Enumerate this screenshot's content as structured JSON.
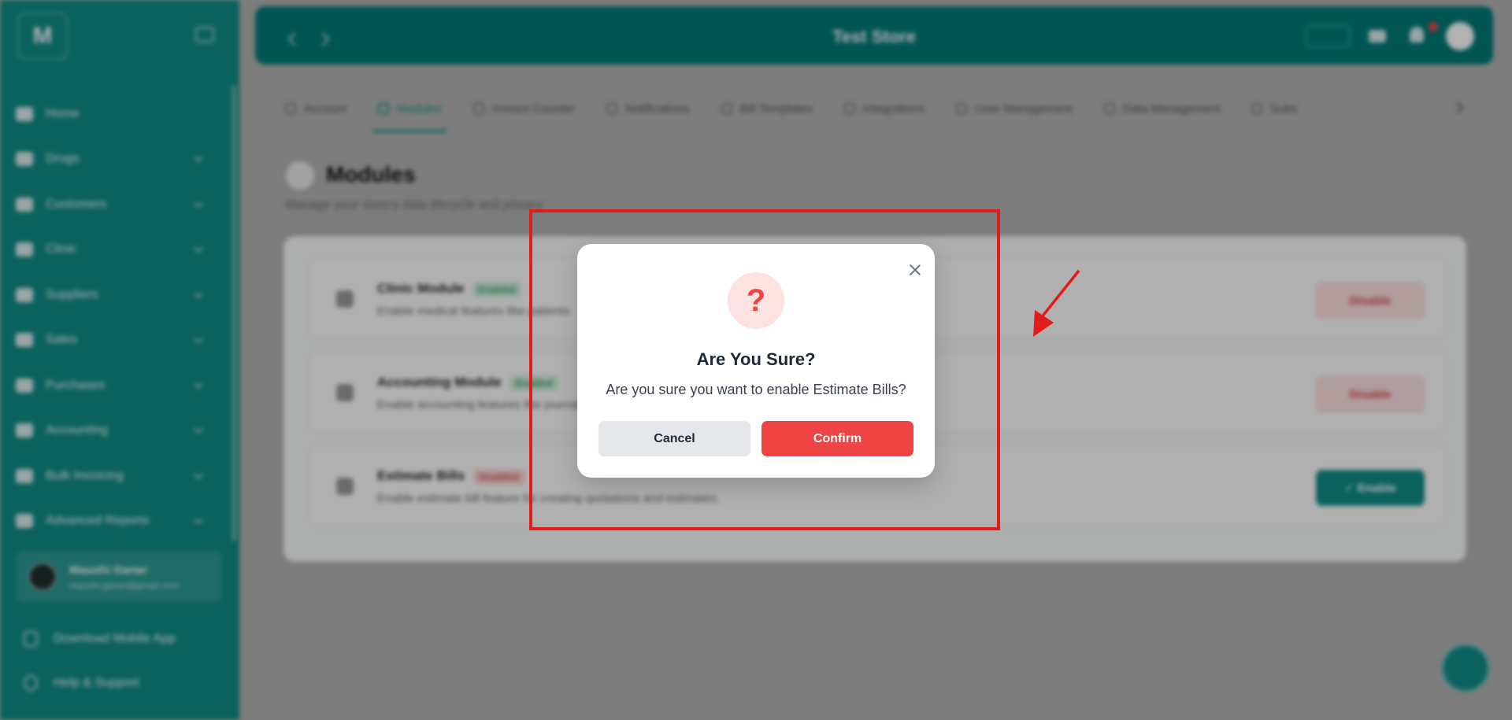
{
  "sidebar": {
    "logo": "M",
    "items": [
      {
        "label": "Home",
        "has_chevron": false
      },
      {
        "label": "Drugs",
        "has_chevron": true
      },
      {
        "label": "Customers",
        "has_chevron": true
      },
      {
        "label": "Clinic",
        "has_chevron": true
      },
      {
        "label": "Suppliers",
        "has_chevron": true
      },
      {
        "label": "Sales",
        "has_chevron": true
      },
      {
        "label": "Purchases",
        "has_chevron": true
      },
      {
        "label": "Accounting",
        "has_chevron": true
      },
      {
        "label": "Bulk Invoicing",
        "has_chevron": true
      },
      {
        "label": "Advanced Reports",
        "has_chevron": true
      }
    ],
    "user": {
      "name": "Maushi Ganar",
      "email": "maushi.ganar@gmail.com"
    },
    "download_app": "Download Mobile App",
    "help": "Help & Support"
  },
  "topbar": {
    "title": "Test Store"
  },
  "tabs": [
    {
      "label": "Account",
      "active": false
    },
    {
      "label": "Modules",
      "active": true
    },
    {
      "label": "Invoice Counter",
      "active": false
    },
    {
      "label": "Notifications",
      "active": false
    },
    {
      "label": "Bill Templates",
      "active": false
    },
    {
      "label": "Integrations",
      "active": false
    },
    {
      "label": "User Management",
      "active": false
    },
    {
      "label": "Data Management",
      "active": false
    },
    {
      "label": "Subs",
      "active": false
    }
  ],
  "page": {
    "title": "Modules",
    "subtitle": "Manage your store's data lifecycle and privacy"
  },
  "modules": [
    {
      "name": "Clinic Module",
      "status": "Enabled",
      "status_on": true,
      "desc": "Enable medical features like patients",
      "button": "Disable"
    },
    {
      "name": "Accounting Module",
      "status": "Enabled",
      "status_on": true,
      "desc": "Enable accounting features like journals",
      "button": "Disable"
    },
    {
      "name": "Estimate Bills",
      "status": "Disabled",
      "status_on": false,
      "desc": "Enable estimate bill feature for creating quotations and estimates.",
      "button": "✓ Enable"
    }
  ],
  "dialog": {
    "icon": "?",
    "title": "Are You Sure?",
    "message": "Are you sure you want to enable Estimate Bills?",
    "cancel_label": "Cancel",
    "confirm_label": "Confirm"
  },
  "colors": {
    "brand": "#0f8c86",
    "confirm": "#ef4444",
    "annotation": "#e21b1b"
  }
}
